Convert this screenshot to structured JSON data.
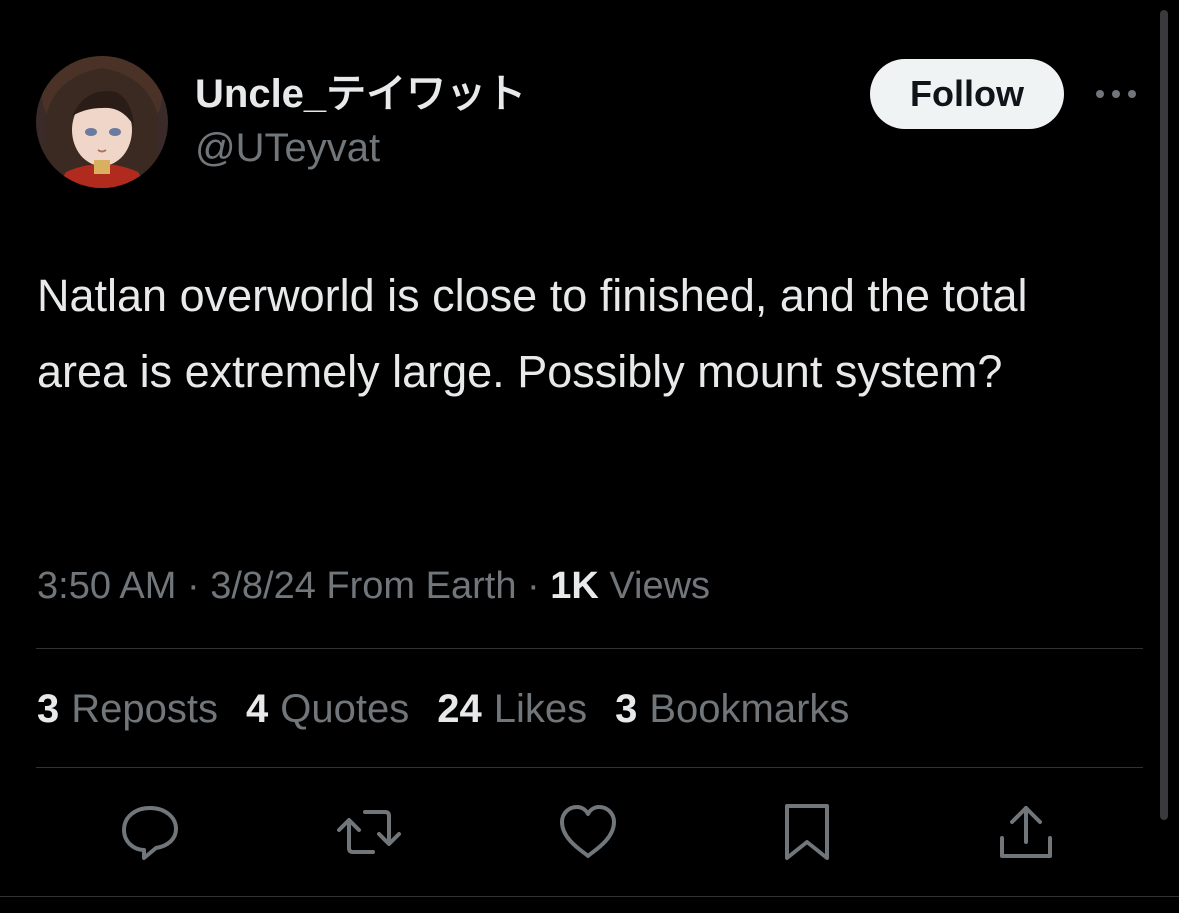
{
  "user": {
    "display_name": "Uncle_テイワット",
    "handle": "@UTeyvat"
  },
  "follow_label": "Follow",
  "tweet": {
    "text": "Natlan overworld is close to finished, and the total area is extremely large. Possibly mount system?"
  },
  "meta": {
    "time": "3:50 AM",
    "sep1": "·",
    "date_location": "3/8/24 From Earth",
    "sep2": "·",
    "views_count": "1K",
    "views_label": "Views"
  },
  "stats": [
    {
      "count": "3",
      "label": "Reposts"
    },
    {
      "count": "4",
      "label": "Quotes"
    },
    {
      "count": "24",
      "label": "Likes"
    },
    {
      "count": "3",
      "label": "Bookmarks"
    }
  ],
  "actions": [
    "reply-icon",
    "repost-icon",
    "like-icon",
    "bookmark-icon",
    "share-icon"
  ],
  "colors": {
    "background": "#000000",
    "primary_text": "#e7e9ea",
    "secondary_text": "#71767b",
    "follow_bg": "#eff3f4",
    "divider": "#2f3336"
  }
}
